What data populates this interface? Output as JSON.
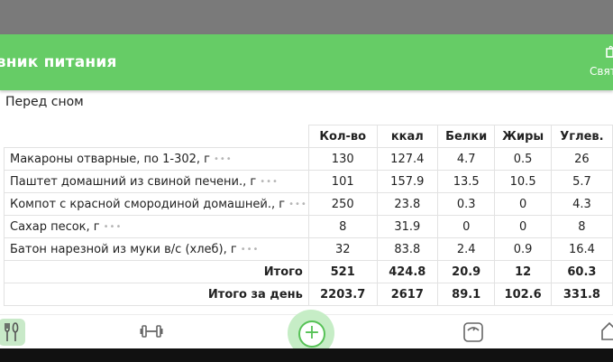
{
  "appbar": {
    "title": "евник питания",
    "action_label": "Свят"
  },
  "section": {
    "title": "Перед сном"
  },
  "table": {
    "headers": [
      "Кол-во",
      "ккал",
      "Белки",
      "Жиры",
      "Углев."
    ],
    "rows": [
      {
        "name": "Макароны отварные, по 1-302, г",
        "qty": "130",
        "kcal": "127.4",
        "protein": "4.7",
        "fat": "0.5",
        "carbs": "26"
      },
      {
        "name": "Паштет домашний из свиной печени., г",
        "qty": "101",
        "kcal": "157.9",
        "protein": "13.5",
        "fat": "10.5",
        "carbs": "5.7"
      },
      {
        "name": "Компот с красной смородиной домашней., г",
        "qty": "250",
        "kcal": "23.8",
        "protein": "0.3",
        "fat": "0",
        "carbs": "4.3"
      },
      {
        "name": "Сахар песок, г",
        "qty": "8",
        "kcal": "31.9",
        "protein": "0",
        "fat": "0",
        "carbs": "8"
      },
      {
        "name": "Батон нарезной из муки в/с (хлеб), г",
        "qty": "32",
        "kcal": "83.8",
        "protein": "2.4",
        "fat": "0.9",
        "carbs": "16.4"
      }
    ],
    "more_glyph": "•••",
    "total": {
      "label": "Итого",
      "qty": "521",
      "kcal": "424.8",
      "protein": "20.9",
      "fat": "12",
      "carbs": "60.3"
    },
    "day_total": {
      "label": "Итого за день",
      "qty": "2203.7",
      "kcal": "2617",
      "protein": "89.1",
      "fat": "102.6",
      "carbs": "331.8"
    }
  },
  "bottom_nav": {
    "items": [
      "meals-icon",
      "dumbbell-icon",
      "add-icon",
      "scale-icon",
      "home-icon"
    ],
    "add_glyph": "+"
  },
  "colors": {
    "accent": "#66cc66",
    "active_tab_bg": "#c8e9c8"
  }
}
